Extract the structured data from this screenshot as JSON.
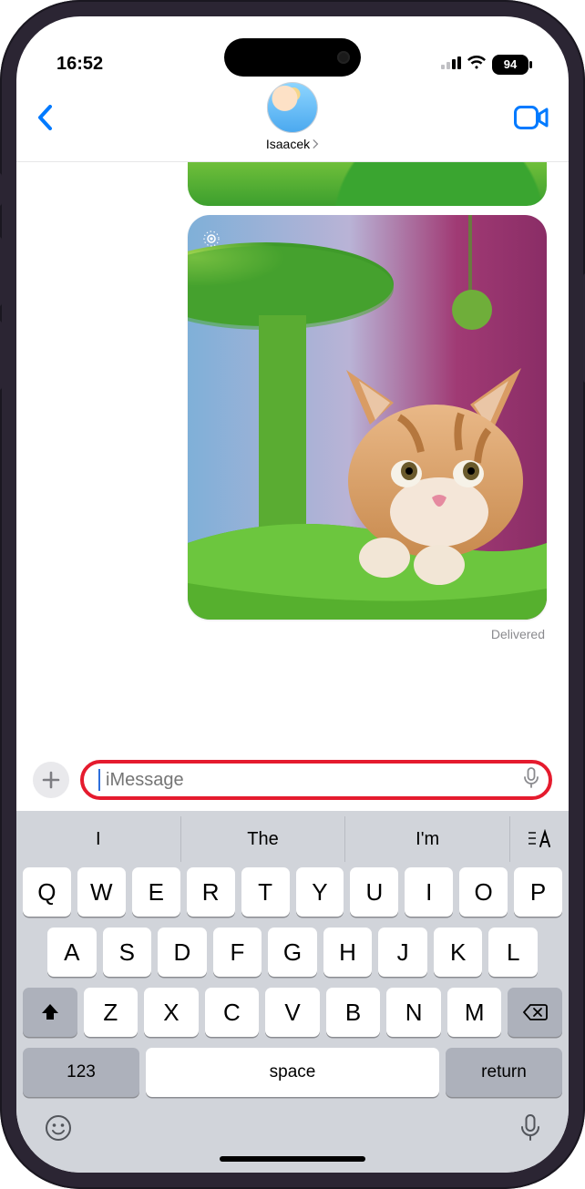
{
  "status": {
    "time": "16:52",
    "battery": "94"
  },
  "contact": {
    "name": "Isaacek"
  },
  "conversation": {
    "delivered_text": "Delivered"
  },
  "compose": {
    "placeholder": "iMessage"
  },
  "keyboard": {
    "suggestions": [
      "I",
      "The",
      "I'm"
    ],
    "row1": [
      "Q",
      "W",
      "E",
      "R",
      "T",
      "Y",
      "U",
      "I",
      "O",
      "P"
    ],
    "row2": [
      "A",
      "S",
      "D",
      "F",
      "G",
      "H",
      "J",
      "K",
      "L"
    ],
    "row3": [
      "Z",
      "X",
      "C",
      "V",
      "B",
      "N",
      "M"
    ],
    "num_key": "123",
    "space_key": "space",
    "return_key": "return"
  }
}
